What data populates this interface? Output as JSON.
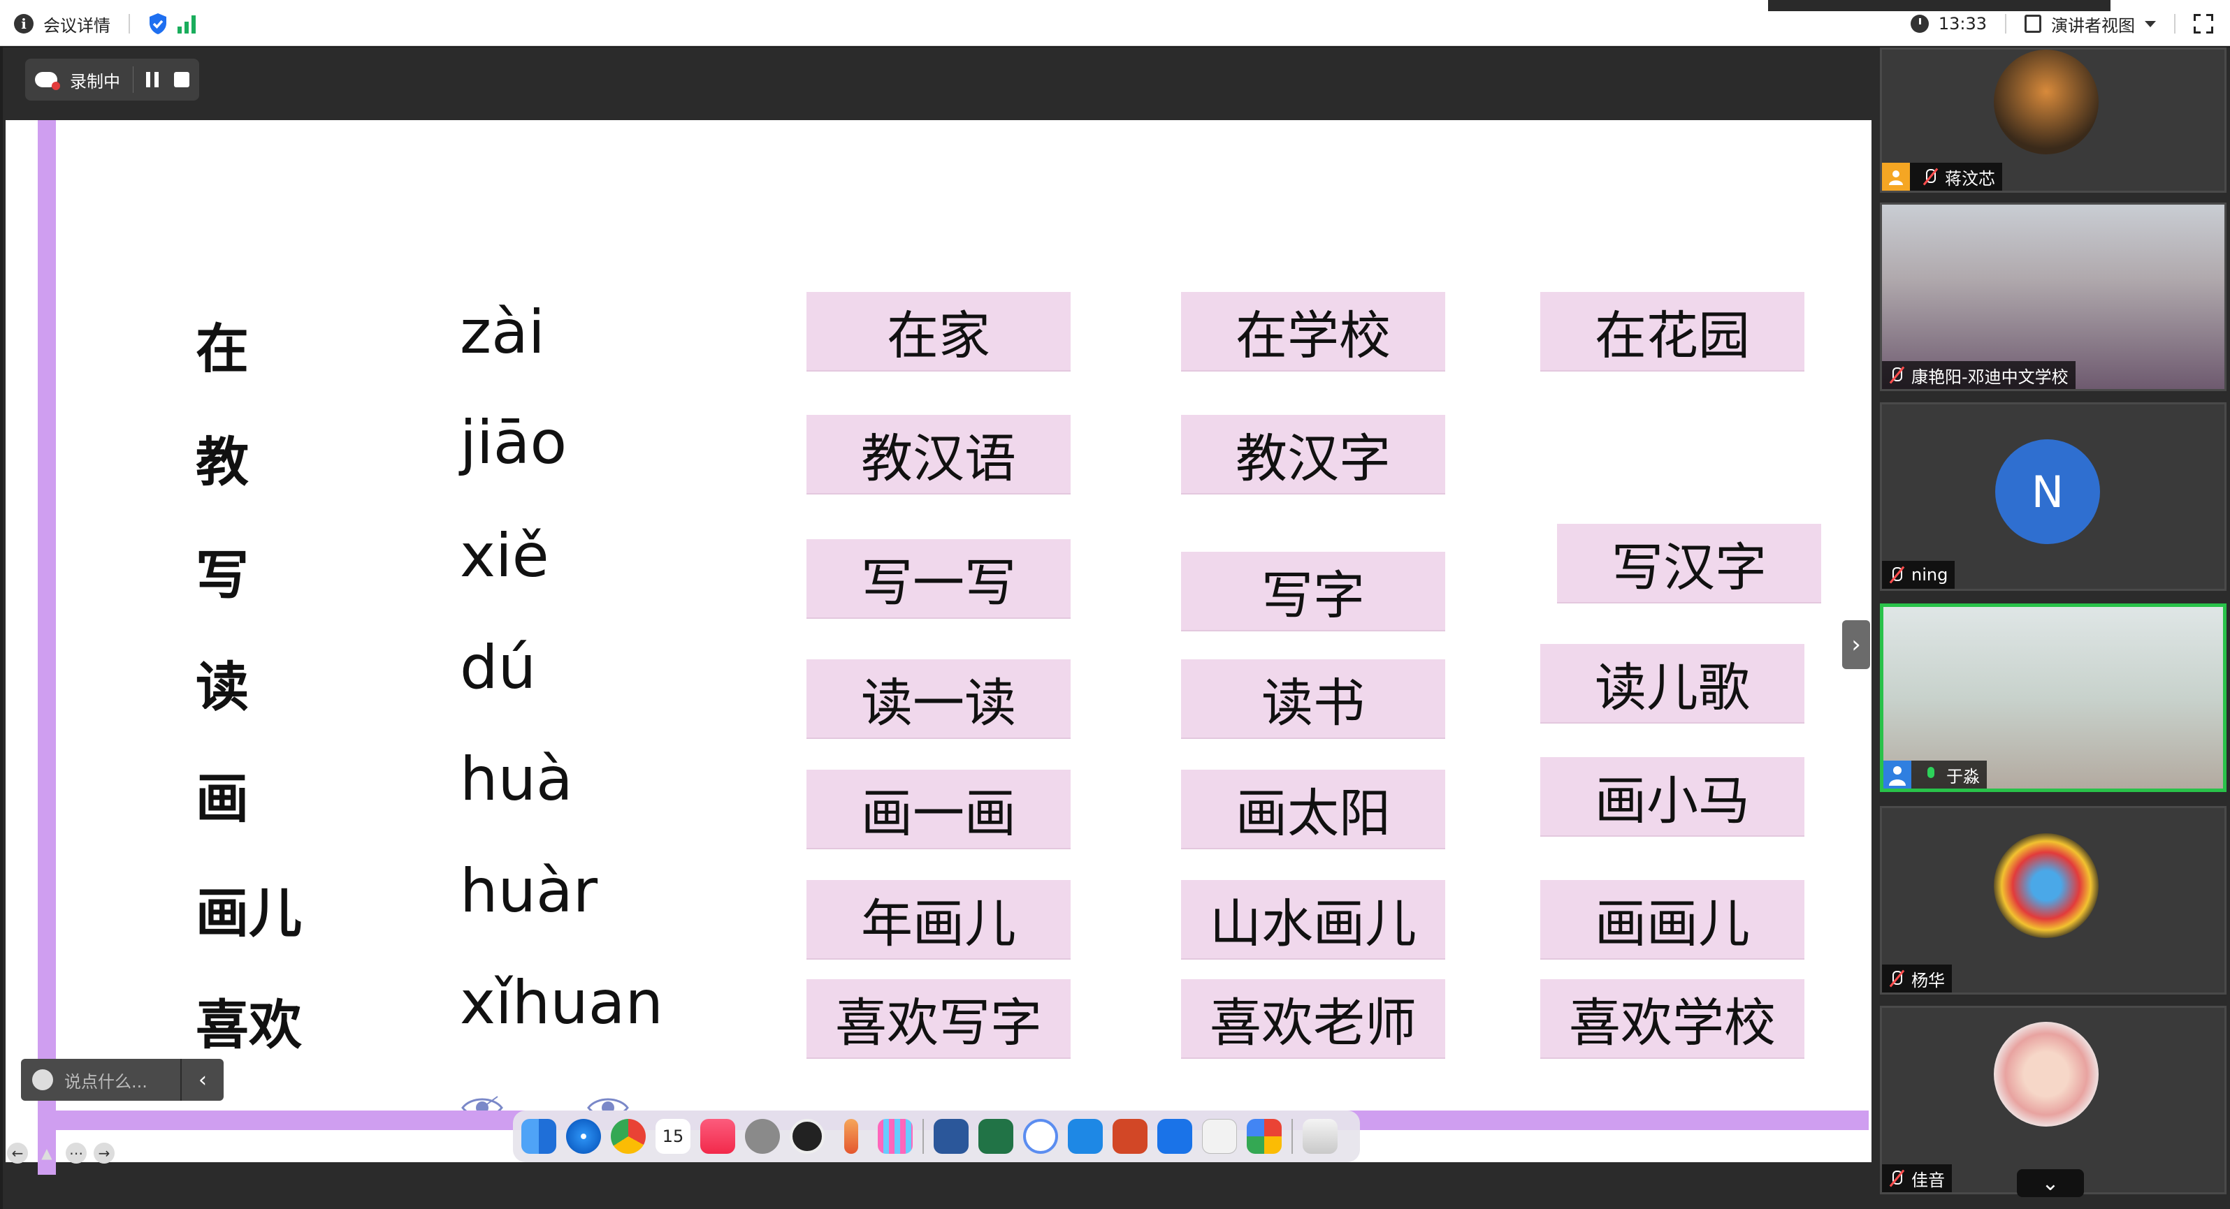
{
  "topbar": {
    "meeting_details": "会议详情",
    "time": "13:33",
    "view_mode": "演讲者视图"
  },
  "recording": {
    "label": "录制中"
  },
  "slide": {
    "rows": [
      {
        "hanzi": "在",
        "pinyin": "zài",
        "words": [
          "在家",
          "在学校",
          "在花园"
        ]
      },
      {
        "hanzi": "教",
        "pinyin": "jiāo",
        "words": [
          "教汉语",
          "教汉字"
        ]
      },
      {
        "hanzi": "写",
        "pinyin": "xiě",
        "words": [
          "写一写",
          "写字",
          "写汉字"
        ]
      },
      {
        "hanzi": "读",
        "pinyin": "dú",
        "words": [
          "读一读",
          "读书",
          "读儿歌"
        ]
      },
      {
        "hanzi": "画",
        "pinyin": "huà",
        "words": [
          "画一画",
          "画太阳",
          "画小马"
        ]
      },
      {
        "hanzi": "画儿",
        "pinyin": "huàr",
        "words": [
          "年画儿",
          "山水画儿",
          "画画儿"
        ]
      },
      {
        "hanzi": "喜欢",
        "pinyin": "xǐhuan",
        "words": [
          "喜欢写字",
          "喜欢老师",
          "喜欢学校"
        ]
      }
    ]
  },
  "comment": {
    "placeholder": "说点什么..."
  },
  "dock": {
    "calendar_day": "15"
  },
  "participants": [
    {
      "name": "蒋汶芯",
      "muted": true,
      "role": "host"
    },
    {
      "name": "康艳阳-邓迪中文学校",
      "muted": true
    },
    {
      "name": "ning",
      "muted": true,
      "avatar_letter": "N"
    },
    {
      "name": "于淼",
      "muted": false,
      "role": "cohost",
      "speaking": true
    },
    {
      "name": "杨华",
      "muted": true
    },
    {
      "name": "佳音",
      "muted": true
    }
  ],
  "colors": {
    "card_bg": "#f0d8ec",
    "slide_border": "#cf9ef0",
    "active_speaker": "#29c24a",
    "avatar_blue": "#2f6fd0"
  }
}
